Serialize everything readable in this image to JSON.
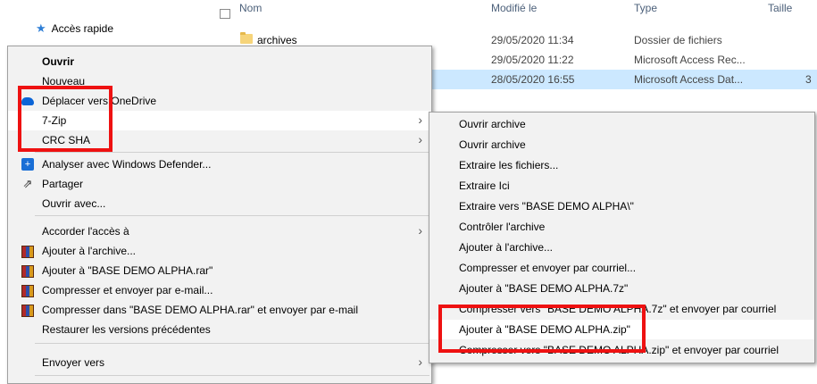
{
  "nav": {
    "quick_access": "Accès rapide"
  },
  "columns": {
    "name": "Nom",
    "modified": "Modifié le",
    "type": "Type",
    "size": "Taille"
  },
  "files": [
    {
      "name": "archives",
      "modified": "29/05/2020 11:34",
      "type": "Dossier de fichiers",
      "size": ""
    },
    {
      "name": "",
      "modified": "29/05/2020 11:22",
      "type": "Microsoft Access Rec...",
      "size": ""
    },
    {
      "name": "",
      "modified": "28/05/2020 16:55",
      "type": "Microsoft Access Dat...",
      "size": "3"
    }
  ],
  "context_menu": {
    "items": [
      {
        "label": "Ouvrir"
      },
      {
        "label": "Nouveau"
      },
      {
        "label": "Déplacer vers OneDrive",
        "icon": "onedrive-icon"
      },
      {
        "label": "7-Zip"
      },
      {
        "label": "CRC SHA"
      },
      {
        "label": "Analyser avec Windows Defender...",
        "icon": "windows-defender-icon"
      },
      {
        "label": "Partager",
        "icon": "share-icon"
      },
      {
        "label": "Ouvrir avec..."
      },
      {
        "label": "Accorder l'accès à"
      },
      {
        "label": "Ajouter à l'archive...",
        "icon": "winrar-icon"
      },
      {
        "label": "Ajouter à \"BASE DEMO ALPHA.rar\"",
        "icon": "winrar-icon"
      },
      {
        "label": "Compresser et envoyer par e-mail...",
        "icon": "winrar-icon"
      },
      {
        "label": "Compresser dans \"BASE DEMO ALPHA.rar\" et envoyer par e-mail",
        "icon": "winrar-icon"
      },
      {
        "label": "Restaurer les versions précédentes"
      },
      {
        "label": "Envoyer vers"
      }
    ]
  },
  "zip_submenu": {
    "items": [
      {
        "label": "Ouvrir archive"
      },
      {
        "label": "Ouvrir archive"
      },
      {
        "label": "Extraire les fichiers..."
      },
      {
        "label": "Extraire Ici"
      },
      {
        "label": "Extraire vers \"BASE DEMO ALPHA\\\""
      },
      {
        "label": "Contrôler l'archive"
      },
      {
        "label": "Ajouter à l'archive..."
      },
      {
        "label": "Compresser et envoyer par courriel..."
      },
      {
        "label": "Ajouter à \"BASE DEMO ALPHA.7z\""
      },
      {
        "label": "Compresser vers \"BASE DEMO ALPHA.7z\" et envoyer par courriel"
      },
      {
        "label": "Ajouter à \"BASE DEMO ALPHA.zip\""
      },
      {
        "label": "Compresser vers \"BASE DEMO ALPHA.zip\" et envoyer par courriel"
      }
    ]
  },
  "colors": {
    "highlight_box": "#ee1111",
    "selected_row": "#cce8ff"
  }
}
